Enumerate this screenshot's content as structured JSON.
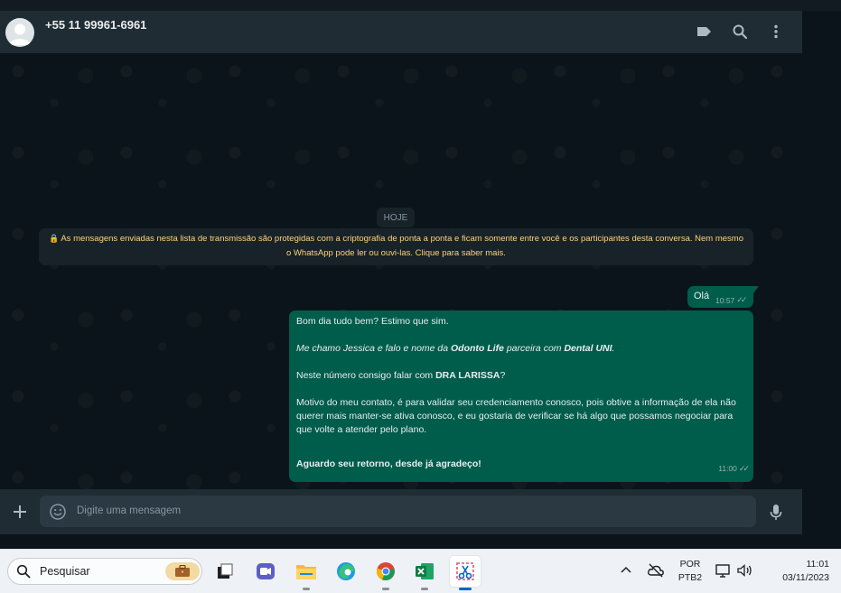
{
  "header": {
    "contact_name": "+55 11 99961-6961",
    "icons": [
      "label-icon",
      "search-icon",
      "menu-dots-icon"
    ]
  },
  "chat": {
    "date_chip": "HOJE",
    "encryption_notice": "As mensagens enviadas nesta lista de transmissão são protegidas com a criptografia de ponta a ponta e ficam somente entre você e os participantes desta conversa. Nem mesmo o WhatsApp pode ler ou ouvi-las. Clique para saber mais.",
    "messages": [
      {
        "text": "Olá",
        "time": "10:57",
        "status": "read-ticks"
      },
      {
        "time": "11:00",
        "status": "read-ticks",
        "line1": "Bom dia tudo bem? Estimo que sim.",
        "line2_a": "Me chamo Jessica e falo e nome da ",
        "line2_b": "Odonto Life",
        "line2_c": " parceira com ",
        "line2_d": "Dental UNI",
        "line2_e": ".",
        "line3_a": "Neste número consigo falar com ",
        "line3_b": "DRA LARISSA",
        "line3_c": "?",
        "line4": "Motivo do meu contato, é para validar seu credenciamento conosco, pois obtive a informação de ela não querer mais manter-se ativa conosco, e eu gostaria de verificar se há algo que possamos negociar para que volte a atender pelo plano.",
        "line5": "Aguardo seu retorno, desde já agradeço!"
      }
    ]
  },
  "composer": {
    "placeholder": "Digite uma mensagem"
  },
  "taskbar": {
    "search_label": "Pesquisar",
    "apps": [
      "task-view-icon",
      "video-chat-icon",
      "file-explorer-icon",
      "edge-icon",
      "chrome-icon",
      "excel-icon",
      "snipping-tool-icon"
    ],
    "language_line1": "POR",
    "language_line2": "PTB2",
    "time": "11:01",
    "date": "03/11/2023"
  },
  "colors": {
    "outgoing_bubble": "#005c4b",
    "chat_background": "#0b141a",
    "panel": "#202c33",
    "notice_text": "#ffd279"
  }
}
